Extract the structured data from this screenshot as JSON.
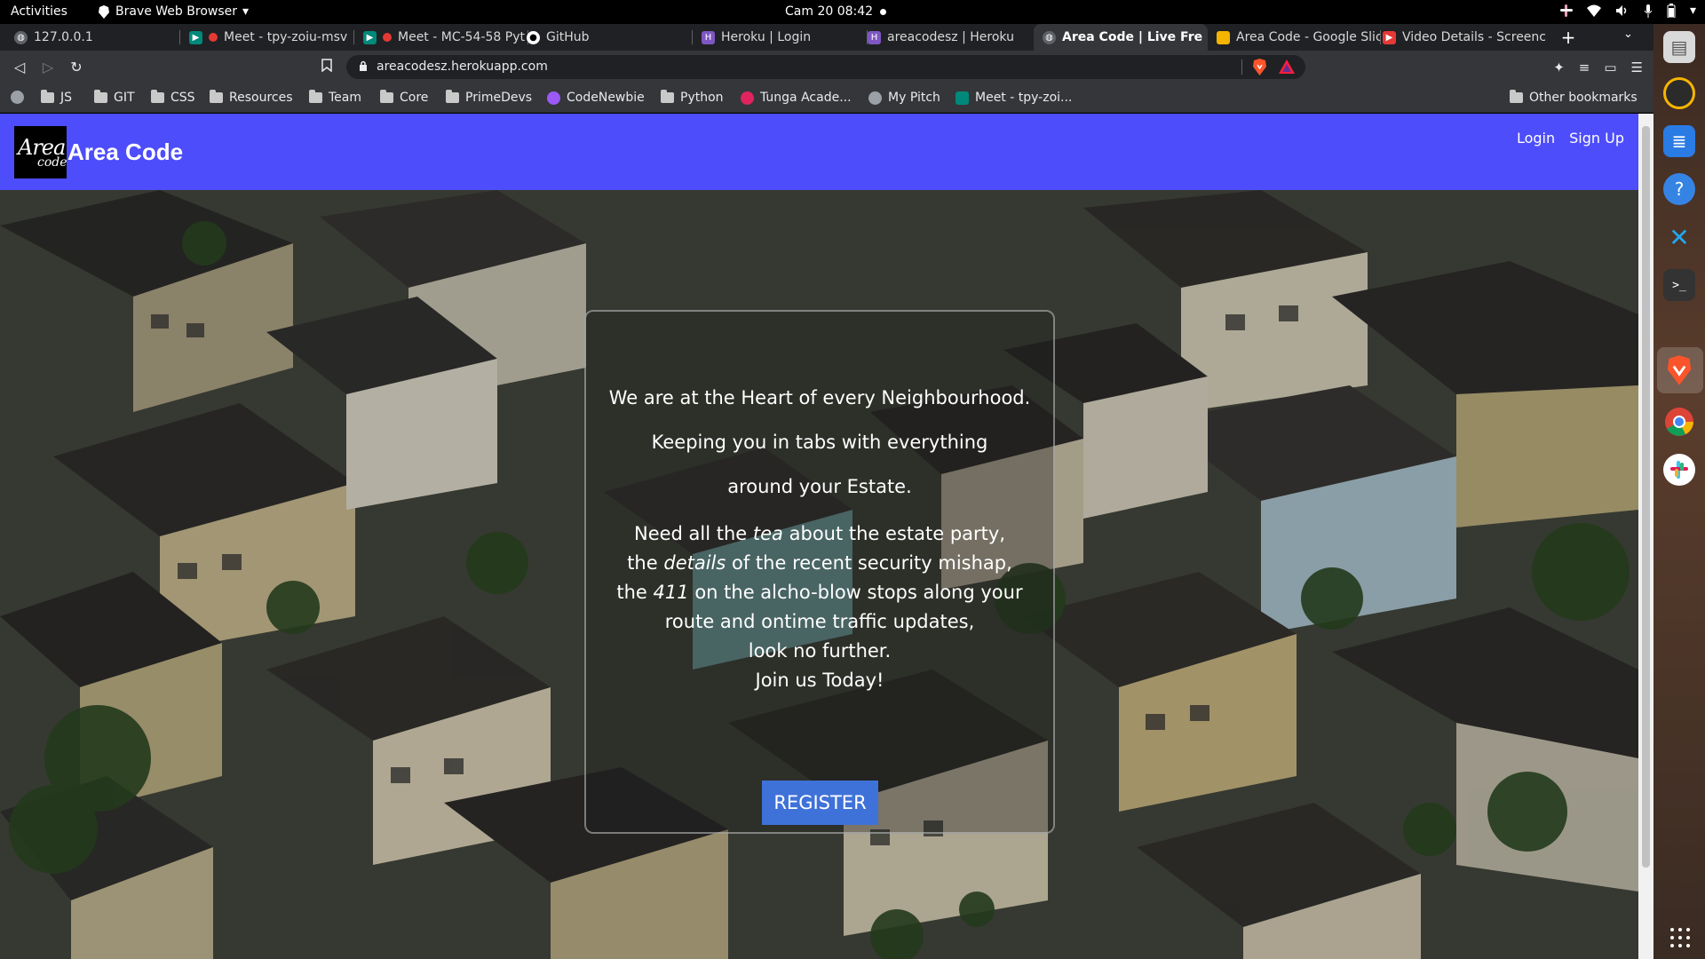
{
  "system": {
    "activities": "Activities",
    "app_name": "Brave Web Browser",
    "clock": "Cam 20  08:42"
  },
  "browser": {
    "tabs": [
      {
        "label": "127.0.0.1",
        "icon": "globe-icon",
        "color": "#9aa0a6"
      },
      {
        "label": "Meet - tpy-zoiu-msv",
        "icon": "meet-icon",
        "color": "#00897b"
      },
      {
        "label": "Meet - MC-54-58 Pyt",
        "icon": "meet-icon",
        "color": "#00897b"
      },
      {
        "label": "GitHub",
        "icon": "github-icon",
        "color": "#ffffff"
      },
      {
        "label": "Heroku | Login",
        "icon": "heroku-icon",
        "color": "#7e57c2"
      },
      {
        "label": "areacodesz | Heroku",
        "icon": "heroku-icon",
        "color": "#7e57c2"
      },
      {
        "label": "Area Code | Live Fre",
        "icon": "globe-icon",
        "color": "#9aa0a6",
        "active": true
      },
      {
        "label": "Area Code - Google Slic",
        "icon": "slides-icon",
        "color": "#f4b400"
      },
      {
        "label": "Video Details - Screenc",
        "icon": "screencast-icon",
        "color": "#e53935"
      }
    ],
    "url": "areacodesz.herokuapp.com",
    "bookmarks": [
      {
        "label": "JS",
        "type": "folder"
      },
      {
        "label": "GIT",
        "type": "folder"
      },
      {
        "label": "CSS",
        "type": "folder"
      },
      {
        "label": "Resources",
        "type": "folder"
      },
      {
        "label": "Team",
        "type": "folder"
      },
      {
        "label": "Core",
        "type": "folder"
      },
      {
        "label": "PrimeDevs",
        "type": "folder"
      },
      {
        "label": "CodeNewbie",
        "type": "site",
        "color": "#9b59f5"
      },
      {
        "label": "Python",
        "type": "folder"
      },
      {
        "label": "Tunga Acade...",
        "type": "site",
        "color": "#e0245e"
      },
      {
        "label": "My Pitch",
        "type": "site",
        "color": "#9aa0a6"
      },
      {
        "label": "Meet - tpy-zoi...",
        "type": "site",
        "color": "#00897b"
      }
    ],
    "other_bookmarks": "Other bookmarks"
  },
  "site": {
    "logo_line1": "Area",
    "logo_line2": "code",
    "brand": "Area Code",
    "nav_login": "Login",
    "nav_signup": "Sign Up",
    "nav_color": "#4d4dfb",
    "hero": {
      "line1": "We are at the Heart of every Neighbourhood.",
      "line2": "Keeping you in tabs with everything",
      "line3": "around your Estate.",
      "p2_line1_a": "Need all the",
      "p2_line1_em": "tea",
      "p2_line1_b": "about the estate party,",
      "p2_line2_a": "the",
      "p2_line2_em": "details",
      "p2_line2_b": "of the recent security mishap,",
      "p2_line3_a": "the",
      "p2_line3_em": "411",
      "p2_line3_b": "on the alcho-blow stops along your",
      "p2_line4": "route and ontime traffic updates,",
      "p2_line5": "look no further.",
      "p2_line6": "Join us Today!",
      "register": "REGISTER"
    }
  }
}
